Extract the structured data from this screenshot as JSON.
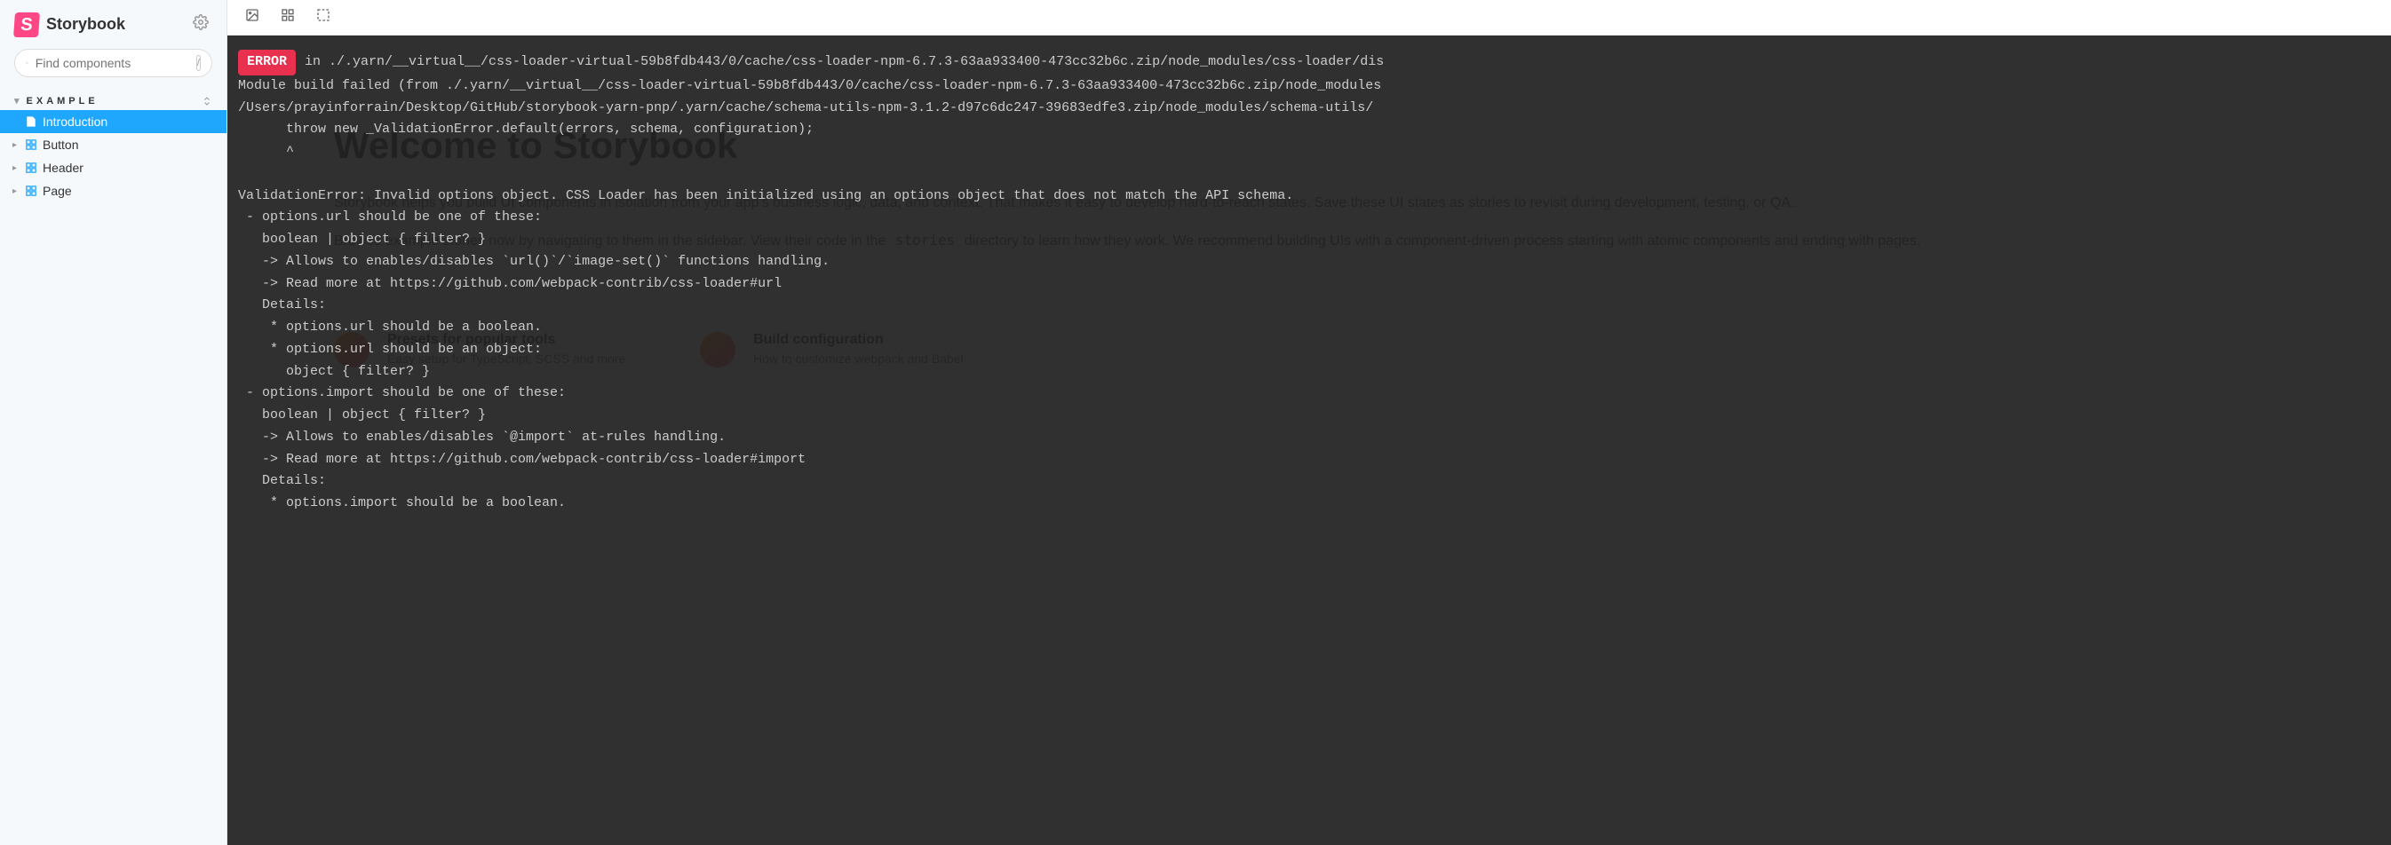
{
  "brand": {
    "name": "Storybook",
    "logo_letter": "S"
  },
  "search": {
    "placeholder": "Find components",
    "shortcut": "/"
  },
  "section": {
    "title": "EXAMPLE"
  },
  "nav": {
    "items": [
      {
        "label": "Introduction",
        "type": "doc",
        "selected": true
      },
      {
        "label": "Button",
        "type": "component",
        "selected": false
      },
      {
        "label": "Header",
        "type": "component",
        "selected": false
      },
      {
        "label": "Page",
        "type": "component",
        "selected": false
      }
    ]
  },
  "bg": {
    "title": "Welcome to Storybook",
    "p1": "Storybook helps you build UI components in isolation from your app's business logic, data, and context. That makes it easy to develop hard-to-reach states. Save these UI states as stories to revisit during development, testing, or QA.",
    "p2a": "Browse example stories now by navigating to them in the sidebar. View their code in the ",
    "p2code": "stories",
    "p2b": " directory to learn how they work. We recommend building UIs with a component-driven process starting with atomic components and ending with pages.",
    "card1_title": "Presets for popular tools",
    "card1_desc": "Easy setup for TypeScript, SCSS and more.",
    "card2_title": "Build configuration",
    "card2_desc": "How to customize webpack and Babel"
  },
  "error": {
    "badge": "ERROR",
    "line_in": "in ./.yarn/__virtual__/css-loader-virtual-59b8fdb443/0/cache/css-loader-npm-6.7.3-63aa933400-473cc32b6c.zip/node_modules/css-loader/dis",
    "line2": "Module build failed (from ./.yarn/__virtual__/css-loader-virtual-59b8fdb443/0/cache/css-loader-npm-6.7.3-63aa933400-473cc32b6c.zip/node_modules",
    "line3": "/Users/prayinforrain/Desktop/GitHub/storybook-yarn-pnp/.yarn/cache/schema-utils-npm-3.1.2-d97c6dc247-39683edfe3.zip/node_modules/schema-utils/",
    "line4": "      throw new _ValidationError.default(errors, schema, configuration);",
    "line5": "      ^",
    "line6": "",
    "line7": "ValidationError: Invalid options object. CSS Loader has been initialized using an options object that does not match the API schema.",
    "line8": " - options.url should be one of these:",
    "line9": "   boolean | object { filter? }",
    "line10": "   -> Allows to enables/disables `url()`/`image-set()` functions handling.",
    "line11": "   -> Read more at https://github.com/webpack-contrib/css-loader#url",
    "line12": "   Details:",
    "line13": "    * options.url should be a boolean.",
    "line14": "    * options.url should be an object:",
    "line15": "      object { filter? }",
    "line16": " - options.import should be one of these:",
    "line17": "   boolean | object { filter? }",
    "line18": "   -> Allows to enables/disables `@import` at-rules handling.",
    "line19": "   -> Read more at https://github.com/webpack-contrib/css-loader#import",
    "line20": "   Details:",
    "line21": "    * options.import should be a boolean."
  }
}
